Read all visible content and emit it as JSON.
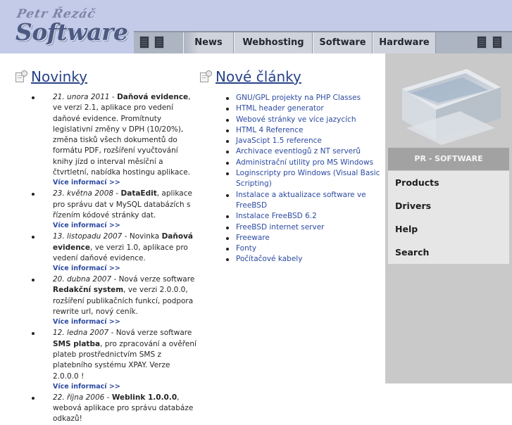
{
  "logo": {
    "top_text": "Petr Řezáč",
    "main_text": "Software"
  },
  "nav": {
    "items": [
      "News",
      "Webhosting",
      "Software",
      "Hardware"
    ]
  },
  "news": {
    "title": "Novinky",
    "items": [
      {
        "date": "21. unora 2011",
        "sep": " - ",
        "bold": "Daňová evidence",
        "text": ", ve verzi 2.1, aplikace pro vedení daňové evidence. Promítnuty legislativní změny v DPH (10/20%), změna tisků všech dokumentů do formátu PDF, rozšíření vyučtování knihy jízd o interval měsíční a čtvrtletní, nabídka hostingu aplikace.",
        "more": "Více informací >>"
      },
      {
        "date": "23. května 2008",
        "sep": " - ",
        "bold": "DataEdit",
        "text": ", aplikace pro správu dat v MySQL databázích s řízením kódové stránky dat.",
        "more": "Více informací >>"
      },
      {
        "date": "13. listopadu 2007",
        "sep": " - Novinka ",
        "bold": "Daňová evidence",
        "text": ", ve verzi 1.0, aplikace pro vedení daňové evidence.",
        "more": "Více informací >>"
      },
      {
        "date": "20. dubna 2007",
        "sep": " - Nová verze software ",
        "bold": "Redakční system",
        "text": ", ve verzi 2.0.0.0, rozšíření publikačních funkcí, podpora rewrite url, nový ceník.",
        "more": "Více informací >>"
      },
      {
        "date": "12. ledna 2007",
        "sep": " - Nová verze software ",
        "bold": "SMS platba",
        "text": ", pro zpracování a ověření plateb prostřednictvím SMS z platebního systému XPAY. Verze 2.0.0.0 !",
        "more": "Více informací >>"
      },
      {
        "date": "22. října 2006",
        "sep": " - ",
        "bold": "Weblink 1.0.0.0",
        "text": ", webová aplikace pro správu databáze odkazů!",
        "more": ""
      }
    ]
  },
  "articles": {
    "title": "Nové články",
    "items": [
      "GNU/GPL projekty na PHP Classes",
      "HTML header generator",
      "Webové stránky ve více jazycích",
      "HTML 4 Reference",
      "JavaScipt 1.5 reference",
      "Archivace eventlogů z NT serverů",
      "Administrační utility pro MS Windows",
      "Loginscripty pro Windows (Visual Basic Scripting)",
      "Instalace a aktualizace software ve FreeBSD",
      "Instalace FreeBSD 6.2",
      "FreeBSD internet server",
      "Freeware",
      "Fonty",
      "Počítačové kabely"
    ]
  },
  "sidebar": {
    "section_label": "PR - SOFTWARE",
    "items": [
      "Products",
      "Drivers",
      "Help",
      "Search"
    ]
  },
  "colors": {
    "header_bg": "#c3cbe9",
    "link": "#2c4aa2",
    "title_link": "#29438a",
    "sidebar_bg": "#c9c9c9"
  }
}
